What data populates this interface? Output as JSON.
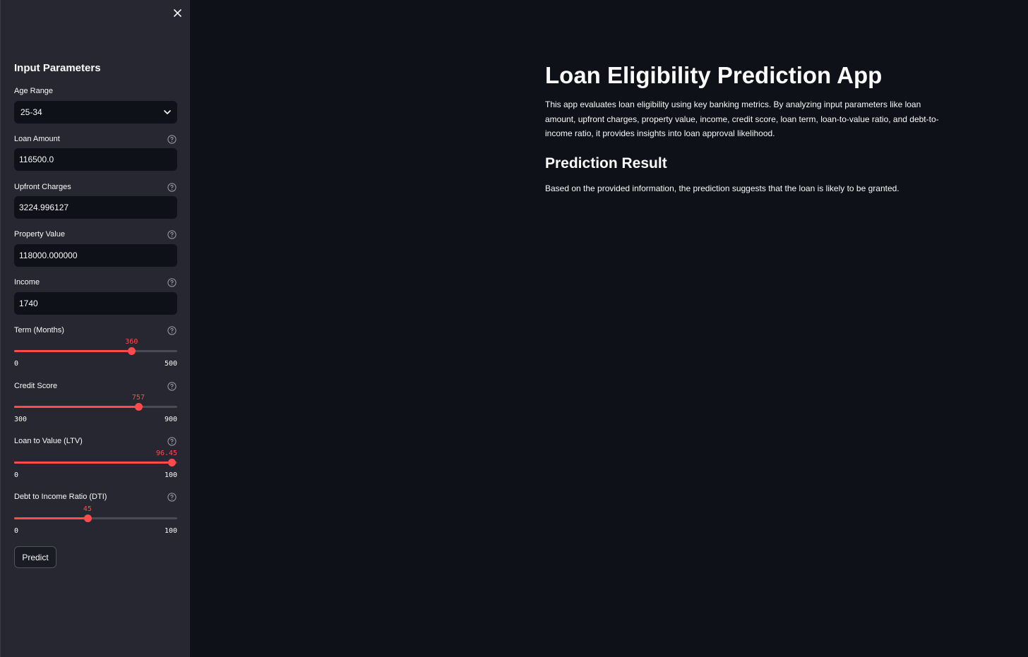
{
  "sidebar": {
    "title": "Input Parameters",
    "age_range": {
      "label": "Age Range",
      "value": "25-34"
    },
    "loan_amount": {
      "label": "Loan Amount",
      "value": "116500.0"
    },
    "upfront_charges": {
      "label": "Upfront Charges",
      "value": "3224.996127"
    },
    "property_value": {
      "label": "Property Value",
      "value": "118000.000000"
    },
    "income": {
      "label": "Income",
      "value": "1740"
    },
    "term": {
      "label": "Term (Months)",
      "value": 360,
      "value_text": "360",
      "min": 0,
      "max": 500,
      "min_text": "0",
      "max_text": "500"
    },
    "credit_score": {
      "label": "Credit Score",
      "value": 757,
      "value_text": "757",
      "min": 300,
      "max": 900,
      "min_text": "300",
      "max_text": "900"
    },
    "ltv": {
      "label": "Loan to Value (LTV)",
      "value": 96.45,
      "value_text": "96.45",
      "min": 0,
      "max": 100,
      "min_text": "0",
      "max_text": "100"
    },
    "dti": {
      "label": "Debt to Income Ratio (DTI)",
      "value": 45,
      "value_text": "45",
      "min": 0,
      "max": 100,
      "min_text": "0",
      "max_text": "100"
    },
    "predict_label": "Predict"
  },
  "main": {
    "title": "Loan Eligibility Prediction App",
    "description": "This app evaluates loan eligibility using key banking metrics. By analyzing input parameters like loan amount, upfront charges, property value, income, credit score, loan term, loan-to-value ratio, and debt-to-income ratio, it provides insights into loan approval likelihood.",
    "result_heading": "Prediction Result",
    "result_text": "Based on the provided information, the prediction suggests that the loan is likely to be granted."
  },
  "colors": {
    "accent": "#ff4b4b",
    "background": "#0e1117",
    "sidebar": "#262730"
  },
  "icons": {
    "close": "close-icon",
    "help": "help-icon",
    "dropdown": "chevron-down-icon"
  }
}
